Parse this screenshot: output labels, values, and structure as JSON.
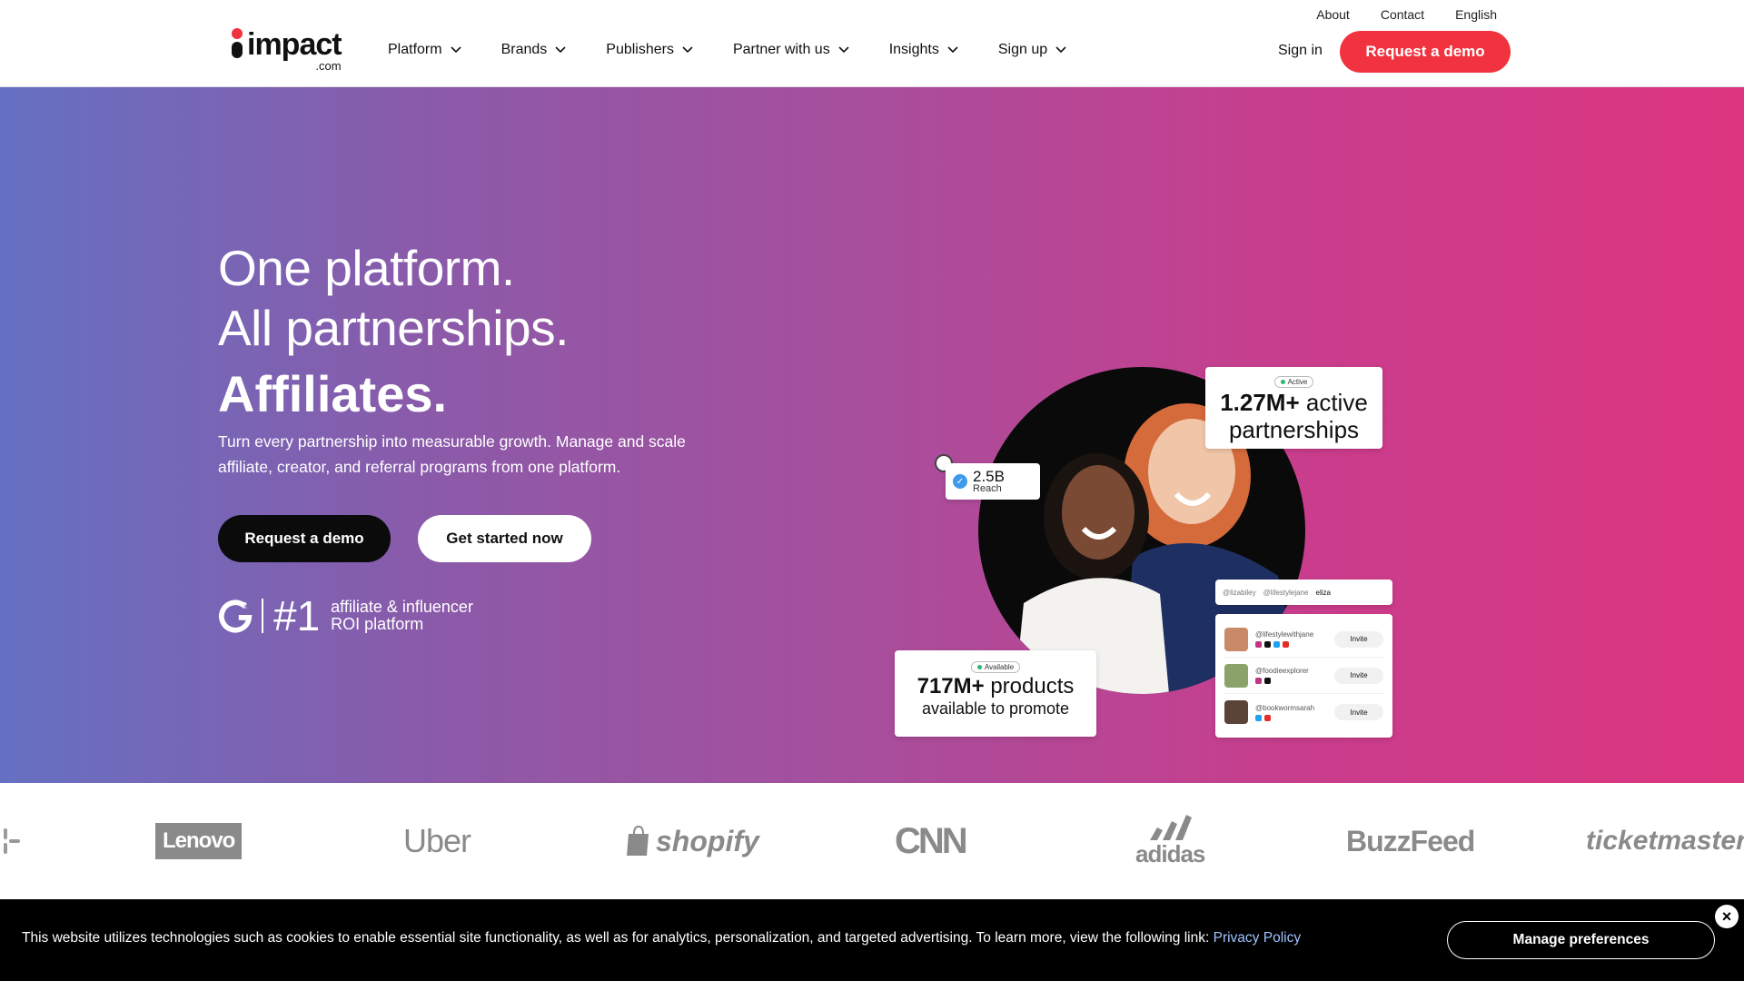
{
  "header": {
    "utility_links": [
      "About",
      "Contact",
      "English"
    ],
    "logo_text": "impact",
    "logo_suffix": ".com",
    "nav": [
      "Platform",
      "Brands",
      "Publishers",
      "Partner with us",
      "Insights",
      "Sign up"
    ],
    "sign_in": "Sign in",
    "request_demo": "Request a demo",
    "accent_color": "#f0333f"
  },
  "hero": {
    "headline_line1": "One platform.",
    "headline_line2": "All partnerships.",
    "headline_rotating": "Affiliates.",
    "subtext": "Turn every partnership into measurable growth. Manage and scale affiliate, creator, and referral programs from one platform.",
    "primary_cta": "Request a demo",
    "secondary_cta": "Get started now",
    "g2_rank": "#1",
    "g2_line1": "affiliate & influencer",
    "g2_line2": "ROI platform",
    "gradient_start": "#6670c2",
    "gradient_end": "#dd3580"
  },
  "visual": {
    "active_badge": "Active",
    "partnerships_number": "1.27M+",
    "partnerships_label_a": "active",
    "partnerships_label_b": "partnerships",
    "reach_number": "2.5B",
    "reach_label": "Reach",
    "available_badge": "Available",
    "products_number": "717M+",
    "products_label_a": "products",
    "products_label_b": "available to promote",
    "search_chips": [
      "@lizabiley",
      "@lifestylejane",
      "eliza"
    ],
    "creators": [
      {
        "handle": "@lifestylewithjane",
        "action": "Invite"
      },
      {
        "handle": "@foodieexplorer",
        "action": "Invite"
      },
      {
        "handle": "@bookwormsarah",
        "action": "Invite"
      }
    ]
  },
  "logos": [
    "Lenovo",
    "Uber",
    "shopify",
    "CNN",
    "adidas",
    "BuzzFeed",
    "ticketmaster"
  ],
  "cookie": {
    "text": "This website utilizes technologies such as cookies to enable essential site functionality, as well as for analytics, personalization, and targeted advertising. To learn more, view the following link:",
    "link": "Privacy Policy",
    "manage": "Manage preferences",
    "close": "×"
  }
}
